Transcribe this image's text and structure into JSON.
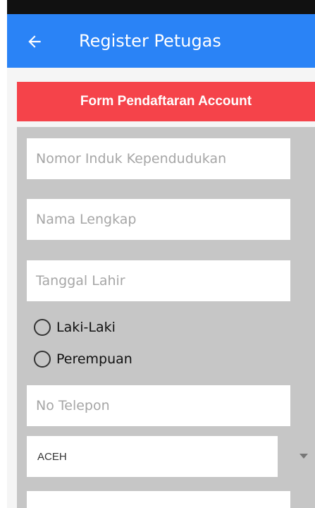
{
  "status_bar": {},
  "app_bar": {
    "title": "Register Petugas",
    "back_icon": "arrow-left-icon"
  },
  "form": {
    "header": "Form Pendaftaran Account",
    "nik_placeholder": "Nomor Induk Kependudukan",
    "name_placeholder": "Nama Lengkap",
    "birthdate_placeholder": "Tanggal Lahir",
    "gender_options": [
      "Laki-Laki",
      "Perempuan"
    ],
    "phone_placeholder": "No Telepon",
    "province_selected": "ACEH"
  },
  "colors": {
    "app_bar": "#2a83f6",
    "header": "#f5434a",
    "form_bg": "#c6c6c6"
  }
}
